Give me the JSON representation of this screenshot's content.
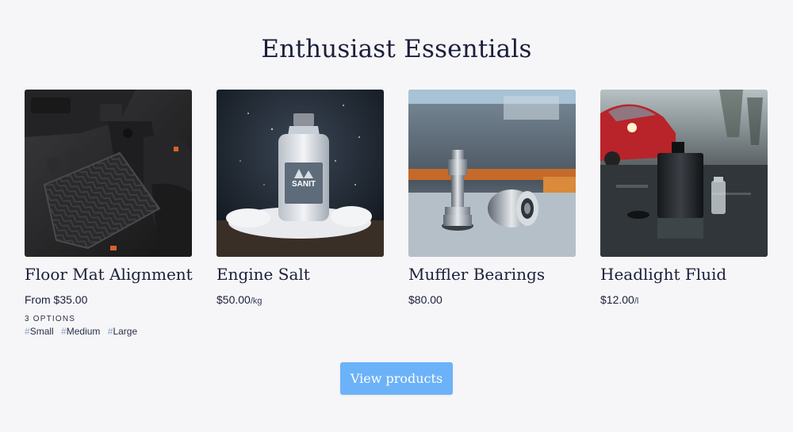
{
  "section": {
    "title": "Enthusiast Essentials"
  },
  "products": [
    {
      "name": "Floor Mat Alignment",
      "price": "From $35.00",
      "unit": "",
      "options_label": "3 OPTIONS",
      "options": [
        "Small",
        "Medium",
        "Large"
      ],
      "image": "floor-mat-image"
    },
    {
      "name": "Engine Salt",
      "price": "$50.00",
      "unit": "/kg",
      "image": "engine-salt-image",
      "label_text": "SANIT"
    },
    {
      "name": "Muffler Bearings",
      "price": "$80.00",
      "unit": "",
      "image": "muffler-bearings-image"
    },
    {
      "name": "Headlight Fluid",
      "price": "$12.00",
      "unit": "/l",
      "image": "headlight-fluid-image"
    }
  ],
  "cta": {
    "label": "View products"
  },
  "option_prefix": "#",
  "colors": {
    "background": "#f6f6f8",
    "heading": "#1b1f3a",
    "button": "#6cb2f8",
    "option_hash": "#8aa3c8"
  }
}
